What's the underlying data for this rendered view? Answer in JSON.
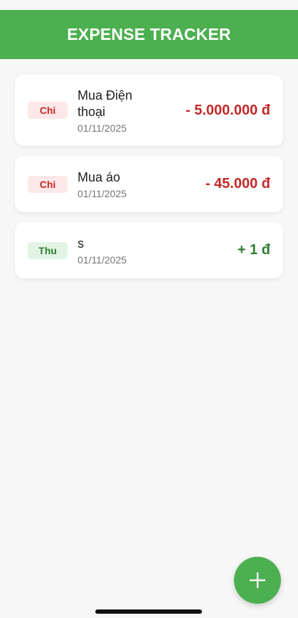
{
  "header": {
    "title": "EXPENSE TRACKER",
    "color": "#4caf50"
  },
  "transactions": [
    {
      "type_label": "Chi",
      "title": "Mua Điện thoại",
      "date": "01/11/2025",
      "amount": "- 5.000.000 đ",
      "kind": "expense"
    },
    {
      "type_label": "Chi",
      "title": "Mua áo",
      "date": "01/11/2025",
      "amount": "- 45.000 đ",
      "kind": "expense"
    },
    {
      "type_label": "Thu",
      "title": "s",
      "date": "01/11/2025",
      "amount": "+ 1 đ",
      "kind": "income"
    }
  ],
  "colors": {
    "expense": "#c62828",
    "income": "#2e7d32",
    "expense_badge_bg": "#fde8e8",
    "income_badge_bg": "#e3f4e4"
  },
  "fab": {
    "icon": "plus-icon"
  }
}
